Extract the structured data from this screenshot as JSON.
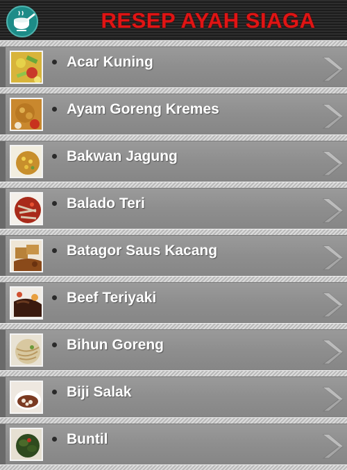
{
  "app": {
    "title": "RESEP AYAH SIAGA",
    "logo_icon": "cooking-pot-icon"
  },
  "colors": {
    "title": "#e01414",
    "logo": "#1d8c88"
  },
  "recipes": [
    {
      "label": "Acar Kuning",
      "thumb": "yellow-pickle"
    },
    {
      "label": "Ayam Goreng Kremes",
      "thumb": "fried-chicken"
    },
    {
      "label": "Bakwan Jagung",
      "thumb": "corn-fritter"
    },
    {
      "label": "Balado Teri",
      "thumb": "anchovy-balado"
    },
    {
      "label": "Batagor Saus Kacang",
      "thumb": "batagor"
    },
    {
      "label": "Beef Teriyaki",
      "thumb": "beef-teriyaki"
    },
    {
      "label": "Bihun Goreng",
      "thumb": "fried-vermicelli"
    },
    {
      "label": "Biji Salak",
      "thumb": "biji-salak"
    },
    {
      "label": "Buntil",
      "thumb": "buntil"
    }
  ],
  "chevron_icon": "chevron-right-icon"
}
